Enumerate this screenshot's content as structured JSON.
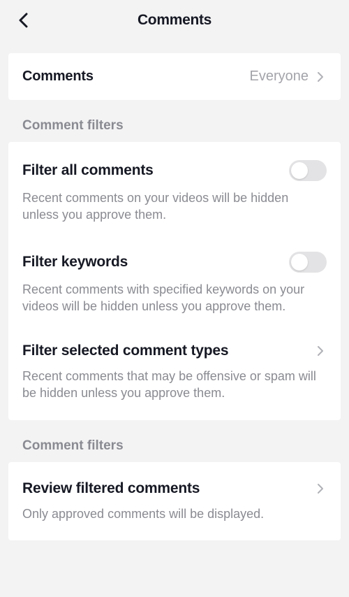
{
  "header": {
    "title": "Comments"
  },
  "commentsSetting": {
    "label": "Comments",
    "value": "Everyone"
  },
  "section1": {
    "header": "Comment filters",
    "items": [
      {
        "title": "Filter all comments",
        "desc": "Recent comments on your videos will be hidden unless you approve them.",
        "toggle": false
      },
      {
        "title": "Filter keywords",
        "desc": "Recent comments with specified keywords on your videos will be hidden unless you approve them.",
        "toggle": false
      },
      {
        "title": "Filter selected comment types",
        "desc": "Recent comments that may be offensive or spam will be hidden unless you approve them."
      }
    ]
  },
  "section2": {
    "header": "Comment filters",
    "items": [
      {
        "title": "Review filtered comments",
        "desc": "Only approved comments will be displayed."
      }
    ]
  }
}
